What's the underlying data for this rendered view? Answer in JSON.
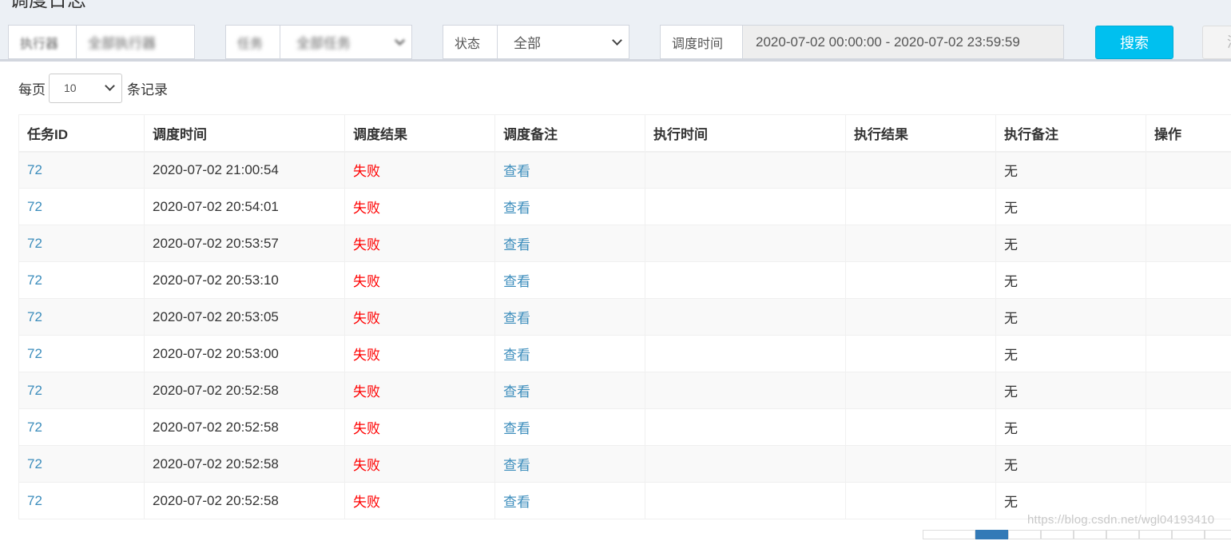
{
  "page": {
    "title": "调度日志"
  },
  "filters": {
    "executor": {
      "label": "执行器",
      "value": "全部执行器"
    },
    "task": {
      "label": "任务",
      "value": "全部任务"
    },
    "status": {
      "label": "状态",
      "value": "全部"
    },
    "time": {
      "label": "调度时间",
      "value": "2020-07-02 00:00:00 - 2020-07-02 23:59:59"
    },
    "search_label": "搜索",
    "clear_label": "清"
  },
  "length": {
    "prefix": "每页",
    "value": "10",
    "suffix": "条记录"
  },
  "table": {
    "headers": [
      "任务ID",
      "调度时间",
      "调度结果",
      "调度备注",
      "执行时间",
      "执行结果",
      "执行备注",
      "操作"
    ],
    "rows": [
      {
        "id": "72",
        "trigger_time": "2020-07-02 21:00:54",
        "trigger_result": "失败",
        "trigger_note": "查看",
        "handle_time": "",
        "handle_result": "",
        "handle_note": "无",
        "op": ""
      },
      {
        "id": "72",
        "trigger_time": "2020-07-02 20:54:01",
        "trigger_result": "失败",
        "trigger_note": "查看",
        "handle_time": "",
        "handle_result": "",
        "handle_note": "无",
        "op": ""
      },
      {
        "id": "72",
        "trigger_time": "2020-07-02 20:53:57",
        "trigger_result": "失败",
        "trigger_note": "查看",
        "handle_time": "",
        "handle_result": "",
        "handle_note": "无",
        "op": ""
      },
      {
        "id": "72",
        "trigger_time": "2020-07-02 20:53:10",
        "trigger_result": "失败",
        "trigger_note": "查看",
        "handle_time": "",
        "handle_result": "",
        "handle_note": "无",
        "op": ""
      },
      {
        "id": "72",
        "trigger_time": "2020-07-02 20:53:05",
        "trigger_result": "失败",
        "trigger_note": "查看",
        "handle_time": "",
        "handle_result": "",
        "handle_note": "无",
        "op": ""
      },
      {
        "id": "72",
        "trigger_time": "2020-07-02 20:53:00",
        "trigger_result": "失败",
        "trigger_note": "查看",
        "handle_time": "",
        "handle_result": "",
        "handle_note": "无",
        "op": ""
      },
      {
        "id": "72",
        "trigger_time": "2020-07-02 20:52:58",
        "trigger_result": "失败",
        "trigger_note": "查看",
        "handle_time": "",
        "handle_result": "",
        "handle_note": "无",
        "op": ""
      },
      {
        "id": "72",
        "trigger_time": "2020-07-02 20:52:58",
        "trigger_result": "失败",
        "trigger_note": "查看",
        "handle_time": "",
        "handle_result": "",
        "handle_note": "无",
        "op": ""
      },
      {
        "id": "72",
        "trigger_time": "2020-07-02 20:52:58",
        "trigger_result": "失败",
        "trigger_note": "查看",
        "handle_time": "",
        "handle_result": "",
        "handle_note": "无",
        "op": ""
      },
      {
        "id": "72",
        "trigger_time": "2020-07-02 20:52:58",
        "trigger_result": "失败",
        "trigger_note": "查看",
        "handle_time": "",
        "handle_result": "",
        "handle_note": "无",
        "op": ""
      }
    ]
  },
  "watermark": "https://blog.csdn.net/wgl04193410",
  "colors": {
    "accent": "#00c0ef",
    "link": "#3c8dbc",
    "fail": "#ff0000"
  }
}
